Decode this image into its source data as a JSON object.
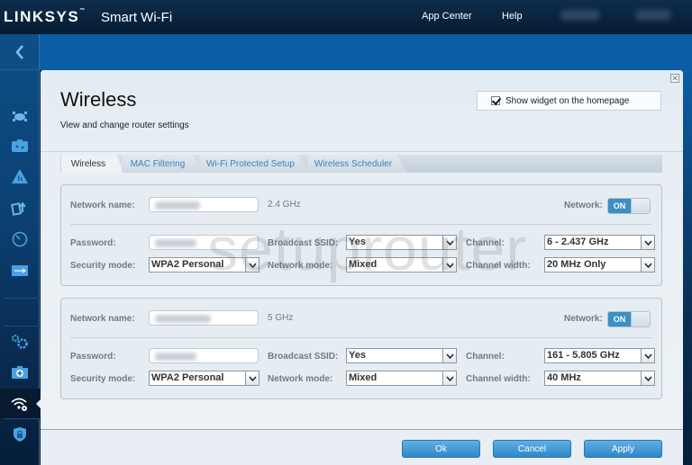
{
  "header": {
    "brand": "LINKSYS",
    "brand_tm": "™",
    "product": "Smart Wi-Fi",
    "nav": [
      "App Center",
      "Help"
    ]
  },
  "sidebar": {
    "back_icon": "chevron-left-icon",
    "items": [
      {
        "name": "device-list-icon",
        "active": false
      },
      {
        "name": "guest-access-icon",
        "active": false
      },
      {
        "name": "parental-controls-icon",
        "active": false
      },
      {
        "name": "media-prioritization-icon",
        "active": false
      },
      {
        "name": "speed-test-icon",
        "active": false
      },
      {
        "name": "external-storage-icon",
        "active": false
      },
      {
        "name": "connectivity-icon",
        "active": false
      },
      {
        "name": "troubleshooting-icon",
        "active": false
      },
      {
        "name": "wireless-icon",
        "active": true
      },
      {
        "name": "security-icon",
        "active": false
      }
    ]
  },
  "page": {
    "title": "Wireless",
    "subtitle": "View and change router settings",
    "widget_checkbox_label": "Show widget on the homepage",
    "widget_checked": true,
    "close_icon": "✕"
  },
  "tabs": [
    {
      "label": "Wireless",
      "active": true
    },
    {
      "label": "MAC Filtering",
      "active": false
    },
    {
      "label": "Wi-Fi Protected Setup",
      "active": false
    },
    {
      "label": "Wireless Scheduler",
      "active": false
    }
  ],
  "networks": [
    {
      "network_name_label": "Network name:",
      "band": "2.4 GHz",
      "network_label": "Network:",
      "network_toggle": "ON",
      "password_label": "Password:",
      "security_mode_label": "Security mode:",
      "security_mode": "WPA2 Personal",
      "broadcast_ssid_label": "Broadcast SSID:",
      "broadcast_ssid": "Yes",
      "network_mode_label": "Network mode:",
      "network_mode": "Mixed",
      "channel_label": "Channel:",
      "channel": "6 - 2.437 GHz",
      "channel_width_label": "Channel width:",
      "channel_width": "20 MHz Only"
    },
    {
      "network_name_label": "Network name:",
      "band": "5 GHz",
      "network_label": "Network:",
      "network_toggle": "ON",
      "password_label": "Password:",
      "security_mode_label": "Security mode:",
      "security_mode": "WPA2 Personal",
      "broadcast_ssid_label": "Broadcast SSID:",
      "broadcast_ssid": "Yes",
      "network_mode_label": "Network mode:",
      "network_mode": "Mixed",
      "channel_label": "Channel:",
      "channel": "161 - 5.805 GHz",
      "channel_width_label": "Channel width:",
      "channel_width": "40 MHz"
    }
  ],
  "footer": {
    "ok_label": "Ok",
    "cancel_label": "Cancel",
    "apply_label": "Apply"
  },
  "watermark": "setuprouter"
}
